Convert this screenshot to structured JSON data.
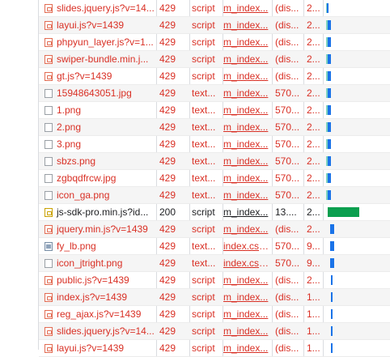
{
  "network": {
    "rows": [
      {
        "name": "slides.jquery.js?v=14...",
        "status": "429",
        "type": "script",
        "initiator": "m_index...",
        "size": "(dis...",
        "time": "2...",
        "icon": "js-file-icon",
        "state": "error"
      },
      {
        "name": "layui.js?v=1439",
        "status": "429",
        "type": "script",
        "initiator": "m_index...",
        "size": "(dis...",
        "time": "2...",
        "icon": "js-file-icon",
        "state": "error"
      },
      {
        "name": "phpyun_layer.js?v=1...",
        "status": "429",
        "type": "script",
        "initiator": "m_index...",
        "size": "(dis...",
        "time": "2...",
        "icon": "js-file-icon",
        "state": "error"
      },
      {
        "name": "swiper-bundle.min.j...",
        "status": "429",
        "type": "script",
        "initiator": "m_index...",
        "size": "(dis...",
        "time": "2...",
        "icon": "js-file-icon",
        "state": "error"
      },
      {
        "name": "gt.js?v=1439",
        "status": "429",
        "type": "script",
        "initiator": "m_index...",
        "size": "(dis...",
        "time": "2...",
        "icon": "js-file-icon",
        "state": "error"
      },
      {
        "name": "15948643051.jpg",
        "status": "429",
        "type": "text...",
        "initiator": "m_index...",
        "size": "570...",
        "time": "2...",
        "icon": "blank-file-icon",
        "state": "error"
      },
      {
        "name": "1.png",
        "status": "429",
        "type": "text...",
        "initiator": "m_index...",
        "size": "570...",
        "time": "2...",
        "icon": "blank-file-icon",
        "state": "error"
      },
      {
        "name": "2.png",
        "status": "429",
        "type": "text...",
        "initiator": "m_index...",
        "size": "570...",
        "time": "2...",
        "icon": "blank-file-icon",
        "state": "error"
      },
      {
        "name": "3.png",
        "status": "429",
        "type": "text...",
        "initiator": "m_index...",
        "size": "570...",
        "time": "2...",
        "icon": "blank-file-icon",
        "state": "error"
      },
      {
        "name": "sbzs.png",
        "status": "429",
        "type": "text...",
        "initiator": "m_index...",
        "size": "570...",
        "time": "2...",
        "icon": "blank-file-icon",
        "state": "error"
      },
      {
        "name": "zgbqdfrcw.jpg",
        "status": "429",
        "type": "text...",
        "initiator": "m_index...",
        "size": "570...",
        "time": "2...",
        "icon": "blank-file-icon",
        "state": "error"
      },
      {
        "name": "icon_ga.png",
        "status": "429",
        "type": "text...",
        "initiator": "m_index...",
        "size": "570...",
        "time": "2...",
        "icon": "blank-file-icon",
        "state": "error"
      },
      {
        "name": "js-sdk-pro.min.js?id...",
        "status": "200",
        "type": "script",
        "initiator": "m_index...",
        "size": "13....",
        "time": "2...",
        "icon": "sdk-file-icon",
        "state": "ok"
      },
      {
        "name": "jquery.min.js?v=1439",
        "status": "429",
        "type": "script",
        "initiator": "m_index...",
        "size": "(dis...",
        "time": "2...",
        "icon": "js-file-icon",
        "state": "error"
      },
      {
        "name": "fy_lb.png",
        "status": "429",
        "type": "text...",
        "initiator": "index.css...",
        "size": "570...",
        "time": "9...",
        "icon": "css-image-icon",
        "state": "error"
      },
      {
        "name": "icon_jtright.png",
        "status": "429",
        "type": "text...",
        "initiator": "index.css...",
        "size": "570...",
        "time": "9...",
        "icon": "blank-file-icon",
        "state": "error"
      },
      {
        "name": "public.js?v=1439",
        "status": "429",
        "type": "script",
        "initiator": "m_index...",
        "size": "(dis...",
        "time": "2...",
        "icon": "js-file-icon",
        "state": "error"
      },
      {
        "name": "index.js?v=1439",
        "status": "429",
        "type": "script",
        "initiator": "m_index...",
        "size": "(dis...",
        "time": "1...",
        "icon": "js-file-icon",
        "state": "error"
      },
      {
        "name": "reg_ajax.js?v=1439",
        "status": "429",
        "type": "script",
        "initiator": "m_index...",
        "size": "(dis...",
        "time": "1...",
        "icon": "js-file-icon",
        "state": "error"
      },
      {
        "name": "slides.jquery.js?v=14...",
        "status": "429",
        "type": "script",
        "initiator": "m_index...",
        "size": "(dis...",
        "time": "1...",
        "icon": "js-file-icon",
        "state": "error"
      },
      {
        "name": "layui.js?v=1439",
        "status": "429",
        "type": "script",
        "initiator": "m_index...",
        "size": "(dis...",
        "time": "1...",
        "icon": "js-file-icon",
        "state": "error"
      }
    ],
    "waterfall": [
      {
        "start": 0.04,
        "width": 0.02,
        "bars": [
          "teal",
          "blue"
        ]
      },
      {
        "start": 0.04,
        "width": 0.07,
        "bars": [
          "teal",
          "blue"
        ]
      },
      {
        "start": 0.04,
        "width": 0.07,
        "bars": [
          "teal",
          "blue"
        ]
      },
      {
        "start": 0.04,
        "width": 0.07,
        "bars": [
          "teal",
          "blue"
        ]
      },
      {
        "start": 0.04,
        "width": 0.07,
        "bars": [
          "teal",
          "blue"
        ]
      },
      {
        "start": 0.04,
        "width": 0.07,
        "bars": [
          "teal",
          "blue"
        ]
      },
      {
        "start": 0.04,
        "width": 0.07,
        "bars": [
          "teal",
          "blue"
        ]
      },
      {
        "start": 0.04,
        "width": 0.07,
        "bars": [
          "teal",
          "blue"
        ]
      },
      {
        "start": 0.04,
        "width": 0.07,
        "bars": [
          "teal",
          "blue"
        ]
      },
      {
        "start": 0.04,
        "width": 0.07,
        "bars": [
          "teal",
          "blue"
        ]
      },
      {
        "start": 0.04,
        "width": 0.07,
        "bars": [
          "teal",
          "blue"
        ]
      },
      {
        "start": 0.04,
        "width": 0.07,
        "bars": [
          "teal",
          "blue"
        ]
      },
      {
        "start": 0.06,
        "width": 0.47,
        "bars": [
          "green"
        ]
      },
      {
        "start": 0.1,
        "width": 0.06,
        "bars": [
          "blue"
        ]
      },
      {
        "start": 0.1,
        "width": 0.06,
        "bars": [
          "blue"
        ]
      },
      {
        "start": 0.1,
        "width": 0.06,
        "bars": [
          "blue"
        ]
      },
      {
        "start": 0.11,
        "width": 0.03,
        "bars": [
          "blue"
        ]
      },
      {
        "start": 0.11,
        "width": 0.03,
        "bars": [
          "blue"
        ]
      },
      {
        "start": 0.11,
        "width": 0.03,
        "bars": [
          "blue"
        ]
      },
      {
        "start": 0.11,
        "width": 0.03,
        "bars": [
          "blue"
        ]
      },
      {
        "start": 0.11,
        "width": 0.03,
        "bars": [
          "blue"
        ]
      }
    ],
    "colors": {
      "error": "#d93025",
      "ok": "#202124",
      "green": "#0b9f4f",
      "blue": "#1a73e8",
      "teal": "#7fd3c0"
    }
  }
}
